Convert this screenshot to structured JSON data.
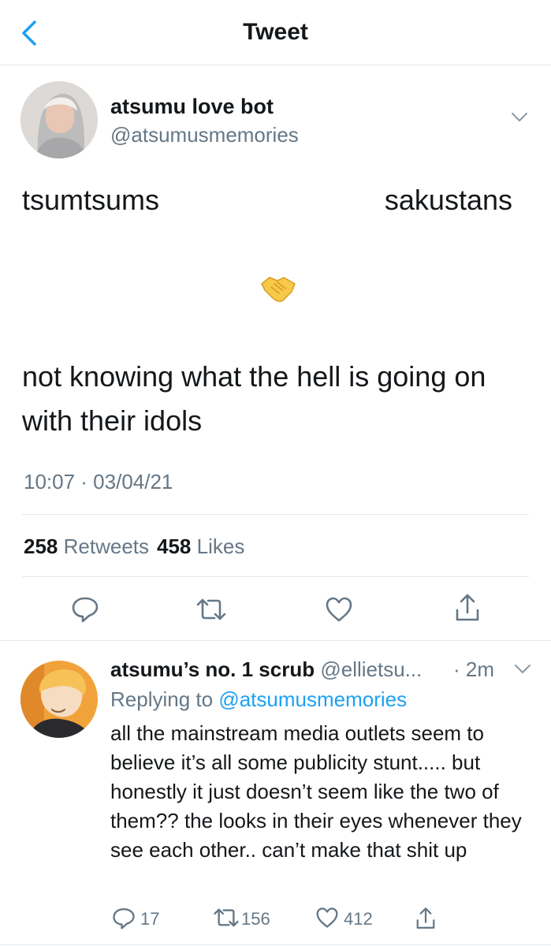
{
  "header": {
    "title": "Tweet"
  },
  "tweet": {
    "author_name": "atsumu love bot",
    "author_handle": "@atsumusmemories",
    "text_left": "tsumtsums",
    "text_right": "sakustans",
    "emoji": "handshake",
    "text_body": "not knowing what the hell is going on with their idols",
    "timestamp": "10:07 · 03/04/21",
    "retweets_count": "258",
    "retweets_label": "Retweets",
    "likes_count": "458",
    "likes_label": "Likes"
  },
  "reply": {
    "author_name": "atsumu’s no. 1 scrub",
    "author_handle": "@ellietsu...",
    "time": "· 2m",
    "replying_prefix": "Replying to",
    "replying_to": "@atsumusmemories",
    "text": "all the mainstream media outlets seem to believe it’s all some publicity stunt..... but honestly it just doesn’t seem like the two of them?? the looks in their eyes whenever they see each other.. can’t make that shit up",
    "reply_count": "17",
    "retweet_count": "156",
    "like_count": "412"
  },
  "colors": {
    "accent": "#1da1f2",
    "secondary_text": "#657786",
    "divider": "#e1e8ed"
  },
  "icons": {
    "back": "chevron-left-icon",
    "more": "chevron-down-icon",
    "reply": "speech-bubble-icon",
    "retweet": "retweet-arrows-icon",
    "like": "heart-icon",
    "share": "share-upload-icon"
  }
}
